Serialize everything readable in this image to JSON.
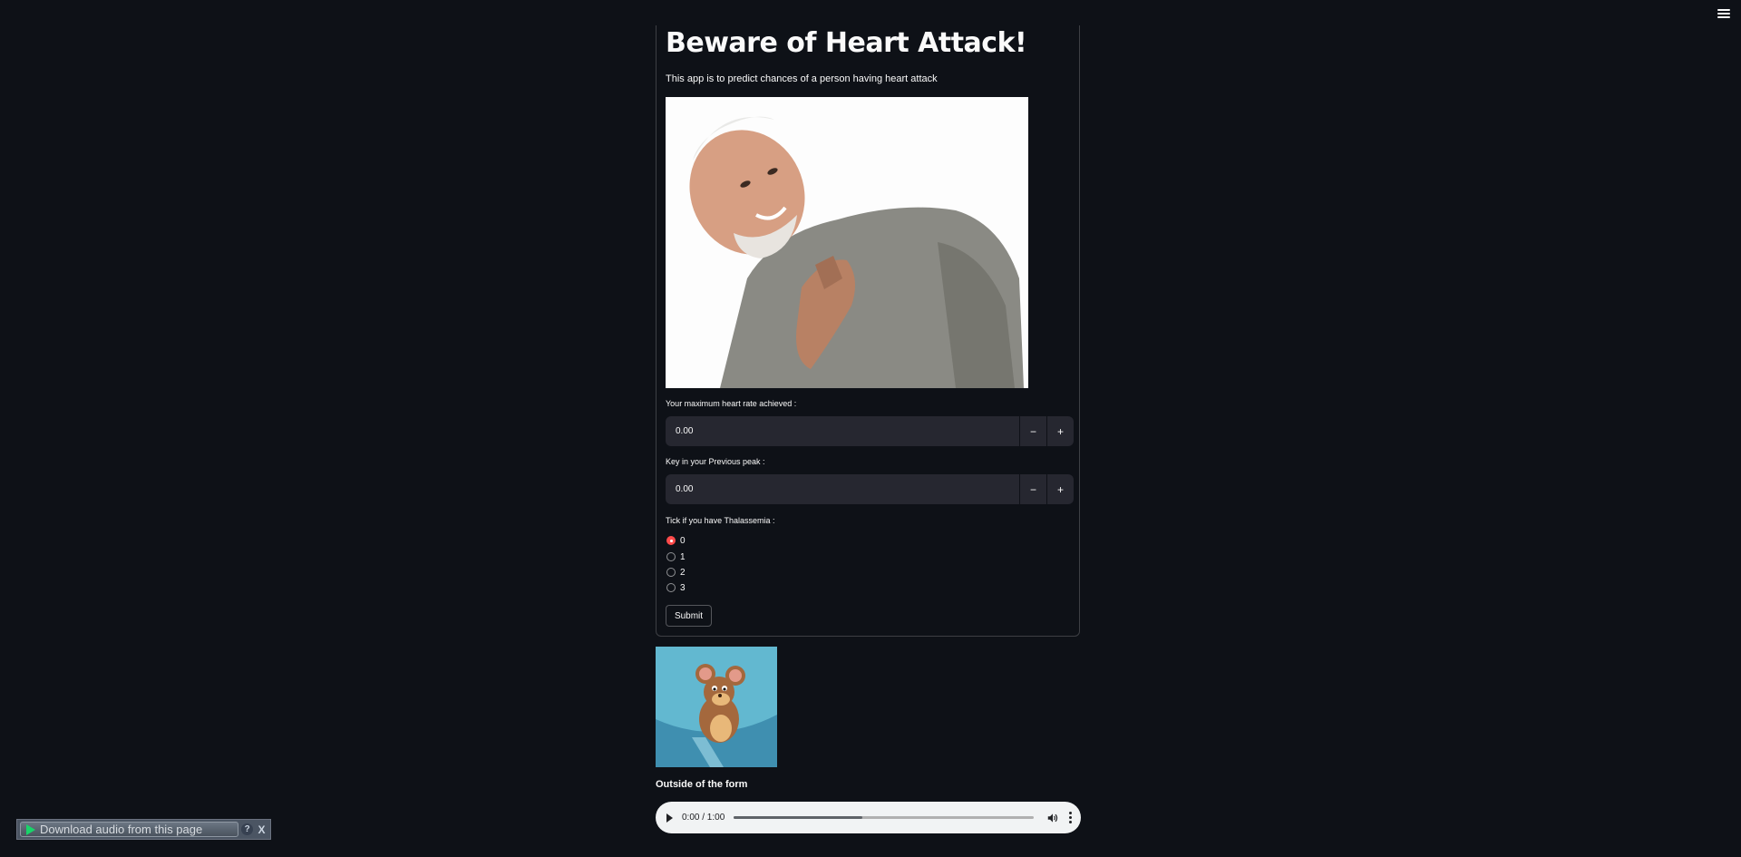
{
  "app": {
    "title": "Beware of Heart Attack!",
    "subtitle": "This app is to predict chances of a person having heart attack"
  },
  "form": {
    "max_heart_rate": {
      "label": "Your maximum heart rate achieved :",
      "value": "0.00",
      "decrement": "−",
      "increment": "+"
    },
    "previous_peak": {
      "label": "Key in your Previous peak :",
      "value": "0.00",
      "decrement": "−",
      "increment": "+"
    },
    "thalassemia": {
      "label": "Tick if you have Thalassemia :",
      "options": [
        "0",
        "1",
        "2",
        "3"
      ],
      "selected": "0"
    },
    "submit_label": "Submit"
  },
  "outside_text": "Outside of the form",
  "audio": {
    "time": "0:00 / 1:00",
    "buffered_fraction": 0.43
  },
  "extension_bar": {
    "download_label": "Download audio from this page",
    "help": "?",
    "close": "X"
  },
  "colors": {
    "background": "#0e1117",
    "accent": "#ff4b4b",
    "input_bg": "#262730"
  },
  "icons": [
    "menu-icon",
    "play-icon",
    "volume-icon",
    "more-vert-icon",
    "help-icon",
    "close-icon"
  ]
}
